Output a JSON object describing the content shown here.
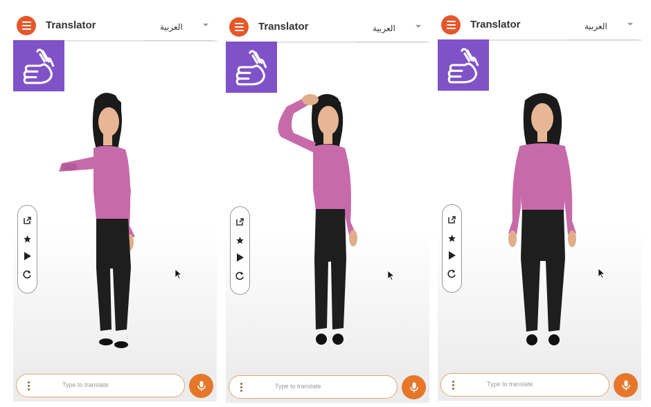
{
  "app": {
    "title": "Translator",
    "language": "العربية",
    "input_placeholder": "Type to translate",
    "accent_color": "#e6572a",
    "sign_badge_color": "#7f52c8"
  },
  "icons": {
    "menu": "hamburger-menu-icon",
    "sign": "sign-language-hand-icon",
    "tools": [
      "open-external-icon",
      "star-icon",
      "play-icon",
      "refresh-icon"
    ],
    "mic": "microphone-icon"
  },
  "panels": [
    {
      "pose": "arm-forward"
    },
    {
      "pose": "hand-on-head"
    },
    {
      "pose": "standing"
    }
  ]
}
